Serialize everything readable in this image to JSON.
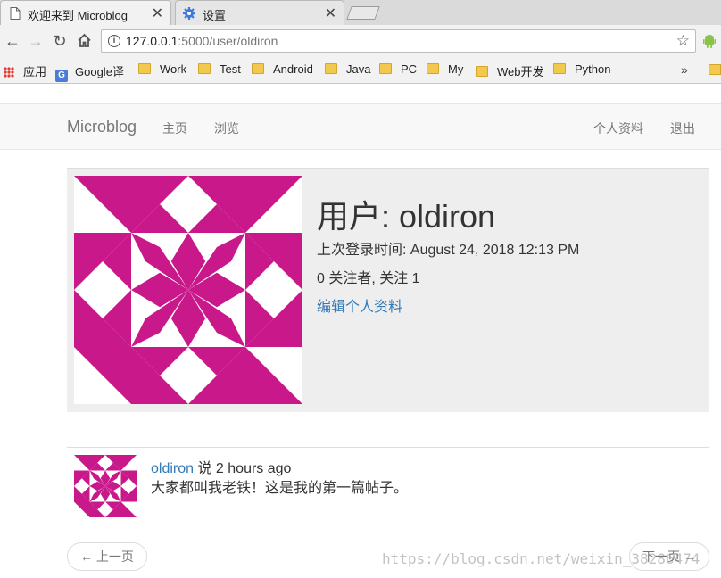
{
  "browser": {
    "tabs": [
      {
        "title": "欢迎来到 Microblog",
        "active": true
      },
      {
        "title": "设置",
        "active": false
      }
    ],
    "url_host": "127.0.0.1",
    "url_path": ":5000/user/oldiron",
    "bookmarks": [
      {
        "label": "应用",
        "icon": "apps-grid-icon"
      },
      {
        "label": "Google译",
        "icon": "google-translate-icon"
      },
      {
        "label": "Work",
        "icon": "folder-icon"
      },
      {
        "label": "Test",
        "icon": "folder-icon"
      },
      {
        "label": "Android",
        "icon": "folder-icon"
      },
      {
        "label": "Java",
        "icon": "folder-icon"
      },
      {
        "label": "PC",
        "icon": "folder-icon"
      },
      {
        "label": "My",
        "icon": "folder-icon"
      },
      {
        "label": "Web开发",
        "icon": "folder-icon"
      },
      {
        "label": "Python",
        "icon": "folder-icon"
      }
    ],
    "more": "»"
  },
  "navbar": {
    "brand": "Microblog",
    "links": [
      "主页",
      "浏览"
    ],
    "right_links": [
      "个人资料",
      "退出"
    ]
  },
  "profile": {
    "title": "用户: oldiron",
    "last_seen": "上次登录时间: August 24, 2018 12:13 PM",
    "follow_stats": "0 关注者, 关注 1",
    "edit_link": "编辑个人资料"
  },
  "post": {
    "author": "oldiron",
    "time_text": " 说 2 hours ago",
    "body": "大家都叫我老铁！这是我的第一篇帖子。"
  },
  "pager": {
    "prev": "← 上一页",
    "next": "下一页 →"
  },
  "watermark": "https://blog.csdn.net/weixin_38286474",
  "colors": {
    "identicon": "#c8188a",
    "link": "#337ab7",
    "navbar_bg": "#f8f8f8",
    "jumbotron_bg": "#eeeeee"
  }
}
